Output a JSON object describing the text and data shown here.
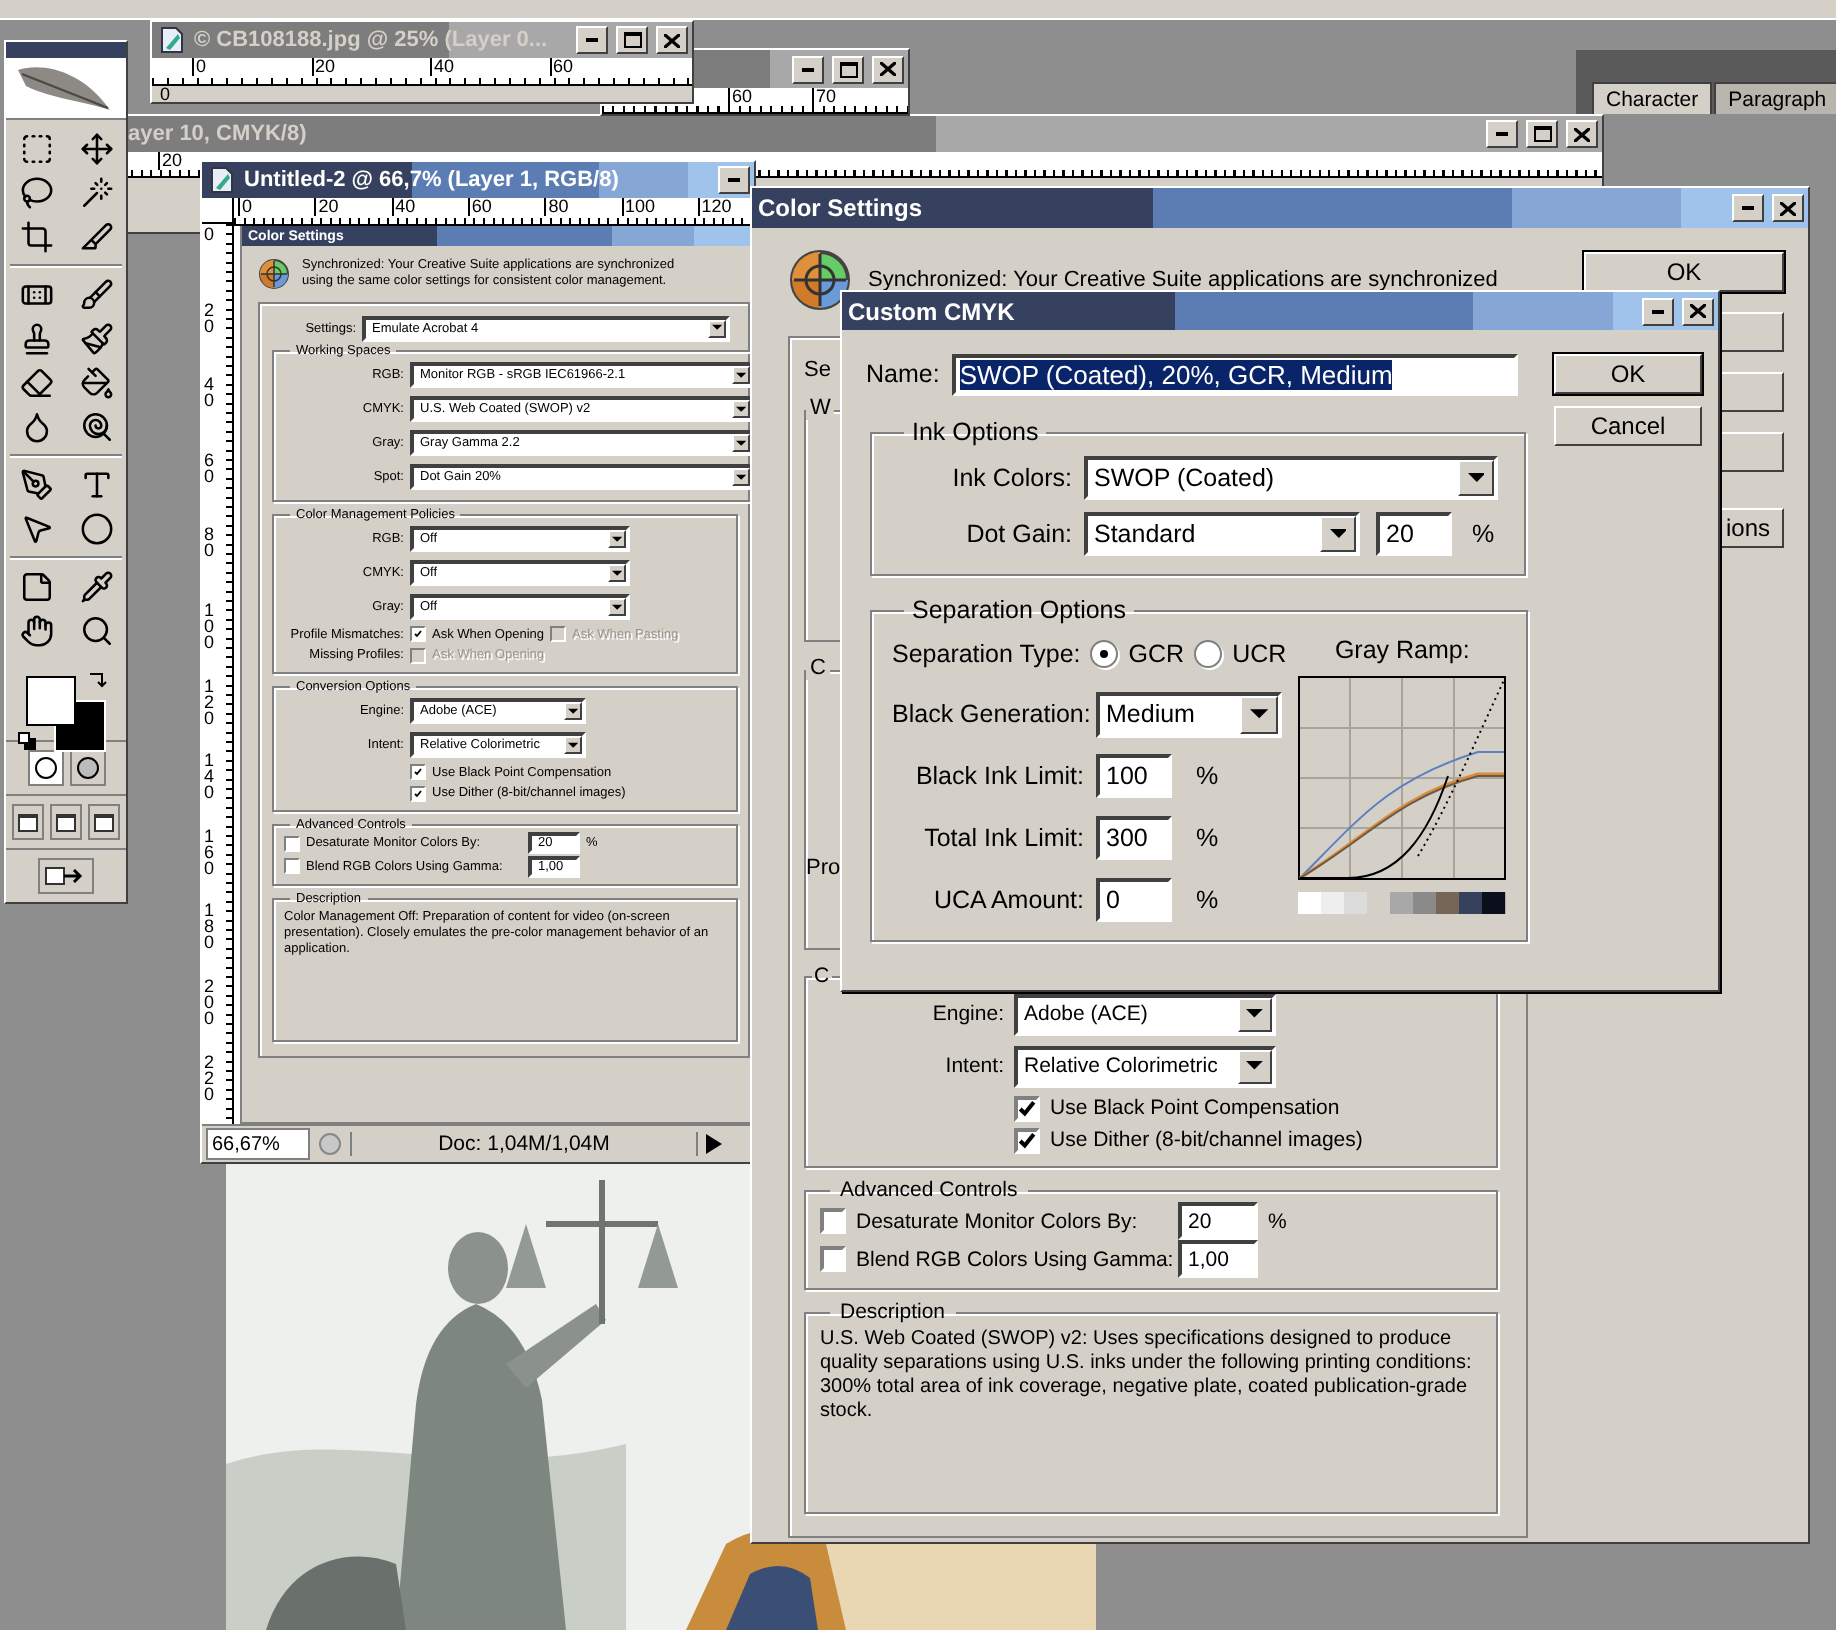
{
  "photo_window": {
    "title": "© CB108188.jpg @ 25% (Layer 0...",
    "ruler": [
      "0",
      "20",
      "40",
      "60"
    ],
    "vertical_ruler": [
      "0"
    ]
  },
  "back_window": {
    "ruler": [
      "60",
      "70"
    ]
  },
  "cmyk_window": {
    "title": "ayer 10, CMYK/8)",
    "ruler": [
      "20"
    ]
  },
  "panel": {
    "tabs": [
      {
        "label": "Character",
        "selected": true
      },
      {
        "label": "Paragraph",
        "selected": false
      }
    ]
  },
  "document": {
    "title": "Untitled-2 @ 66,7% (Layer 1, RGB/8)",
    "ruler": [
      "0",
      "20",
      "40",
      "60",
      "80",
      "100",
      "120"
    ],
    "vertical_ruler": [
      "0",
      "20",
      "40",
      "60",
      "80",
      "100",
      "120",
      "140",
      "160",
      "180",
      "200",
      "220"
    ],
    "zoom": "66,67%",
    "doc_info": "Doc: 1,04M/1,04M",
    "mini_dialog": {
      "title": "Color Settings",
      "sync_text": [
        "Synchronized: Your Creative Suite applications are synchronized",
        "using the same color settings for consistent color management."
      ],
      "settings": {
        "label": "Settings:",
        "value": "Emulate Acrobat 4"
      },
      "groups": [
        {
          "kind": "spaces",
          "title": "Working Spaces",
          "rows": [
            {
              "kind": "select",
              "label": "RGB:",
              "value": "Monitor RGB - sRGB IEC61966-2.1"
            },
            {
              "kind": "select",
              "label": "CMYK:",
              "value": "U.S. Web Coated (SWOP) v2"
            },
            {
              "kind": "select",
              "label": "Gray:",
              "value": "Gray Gamma 2.2"
            },
            {
              "kind": "select",
              "label": "Spot:",
              "value": "Dot Gain 20%"
            }
          ]
        },
        {
          "kind": "policies",
          "title": "Color Management Policies",
          "rows": [
            {
              "kind": "select",
              "label": "RGB:",
              "value": "Off"
            },
            {
              "kind": "select",
              "label": "CMYK:",
              "value": "Off"
            },
            {
              "kind": "select",
              "label": "Gray:",
              "value": "Off"
            },
            {
              "kind": "checks",
              "label": "Profile Mismatches:",
              "items": [
                {
                  "label": "Ask When Opening",
                  "checked": true,
                  "disabled": false
                },
                {
                  "label": "Ask When Pasting",
                  "checked": false,
                  "disabled": true
                }
              ]
            },
            {
              "kind": "checks",
              "label": "Missing Profiles:",
              "items": [
                {
                  "label": "Ask When Opening",
                  "checked": false,
                  "disabled": true
                }
              ]
            }
          ]
        },
        {
          "kind": "conversion",
          "title": "Conversion Options",
          "rows": [
            {
              "kind": "select",
              "label": "Engine:",
              "value": "Adobe (ACE)"
            },
            {
              "kind": "select",
              "label": "Intent:",
              "value": "Relative Colorimetric"
            },
            {
              "kind": "checks",
              "items": [
                {
                  "label": "Use Black Point Compensation",
                  "checked": true,
                  "disabled": false
                }
              ]
            },
            {
              "kind": "checks",
              "items": [
                {
                  "label": "Use Dither (8-bit/channel images)",
                  "checked": true,
                  "disabled": false
                }
              ]
            }
          ]
        },
        {
          "kind": "advanced",
          "title": "Advanced Controls",
          "rows": [
            {
              "kind": "check_input",
              "label": "Desaturate Monitor Colors By:",
              "checked": false,
              "value": "20",
              "unit": "%"
            },
            {
              "kind": "check_input",
              "label": "Blend RGB Colors Using Gamma:",
              "checked": false,
              "value": "1,00"
            }
          ]
        },
        {
          "kind": "description",
          "title": "Description",
          "rows": [
            {
              "kind": "text",
              "text": "Color Management Off:  Preparation of content for video (on-screen presentation). Closely emulates the pre-color management behavior of an application."
            }
          ]
        }
      ]
    }
  },
  "color_settings": {
    "title": "Color Settings",
    "sync_text": "Synchronized: Your Creative Suite applications are synchronized",
    "buttons": [
      {
        "kind": "text",
        "label": "OK"
      },
      {
        "kind": "blank"
      },
      {
        "kind": "blank"
      },
      {
        "kind": "blank"
      },
      {
        "kind": "text",
        "label": "ions"
      }
    ],
    "covered_labels": {
      "settings": "Se",
      "working_spaces": "W",
      "policies": "C",
      "profile_mismatches": "Pro"
    },
    "groups": [
      {
        "kind": "conversion",
        "title": "C",
        "rows": [
          {
            "kind": "select",
            "label": "Engine:",
            "value": "Adobe (ACE)"
          },
          {
            "kind": "select",
            "label": "Intent:",
            "value": "Relative Colorimetric"
          },
          {
            "kind": "checks",
            "items": [
              {
                "label": "Use Black Point Compensation",
                "checked": true,
                "disabled": false
              }
            ]
          },
          {
            "kind": "checks",
            "items": [
              {
                "label": "Use Dither (8-bit/channel images)",
                "checked": true,
                "disabled": false
              }
            ]
          }
        ]
      },
      {
        "kind": "advanced",
        "title": "Advanced Controls",
        "rows": [
          {
            "kind": "check_input",
            "label": "Desaturate Monitor Colors By:",
            "checked": false,
            "value": "20",
            "unit": "%"
          },
          {
            "kind": "check_input",
            "label": "Blend RGB Colors Using Gamma:",
            "checked": false,
            "value": "1,00"
          }
        ]
      },
      {
        "kind": "description",
        "title": "Description",
        "rows": [
          {
            "kind": "text",
            "text": "U.S. Web Coated (SWOP) v2:  Uses specifications designed to produce quality separations using U.S. inks under the following printing conditions: 300% total area of ink coverage, negative plate, coated publication-grade stock."
          }
        ]
      }
    ]
  },
  "custom_cmyk": {
    "title": "Custom CMYK",
    "name": {
      "label": "Name:",
      "value": "SWOP (Coated), 20%, GCR, Medium",
      "text_selected": true
    },
    "buttons": [
      "OK",
      "Cancel"
    ],
    "ink_options": {
      "title": "Ink Options",
      "ink_colors": {
        "label": "Ink Colors:",
        "value": "SWOP (Coated)"
      },
      "dot_gain": {
        "label": "Dot Gain:",
        "value": "Standard",
        "amount": "20",
        "unit": "%"
      }
    },
    "separation": {
      "title": "Separation Options",
      "type_label": "Separation Type:",
      "types": [
        {
          "label": "GCR",
          "selected": true
        },
        {
          "label": "UCR",
          "selected": false
        }
      ],
      "black_generation": {
        "label": "Black Generation:",
        "value": "Medium"
      },
      "limits": [
        {
          "label": "Black Ink Limit:",
          "value": "100",
          "unit": "%"
        },
        {
          "label": "Total Ink Limit:",
          "value": "300",
          "unit": "%"
        },
        {
          "label": "UCA Amount:",
          "value": "0",
          "unit": "%"
        }
      ],
      "gray_ramp_label": "Gray Ramp:"
    }
  }
}
